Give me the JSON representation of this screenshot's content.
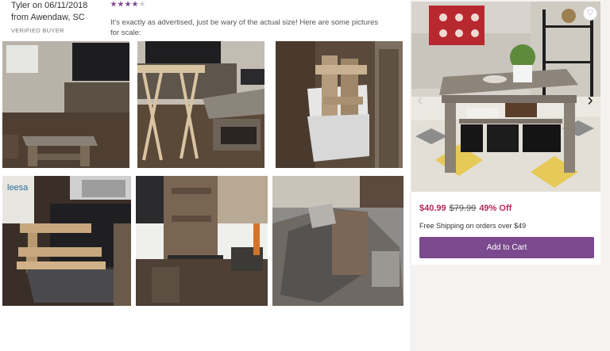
{
  "review": {
    "reviewer_line1": "Tyler on 06/11/2018",
    "reviewer_line2": "from Awendaw, SC",
    "verified": "VERIFIED BUYER",
    "rating": 4,
    "rating_max": 5,
    "text": "It's exactly as advertised, just be wary of the actual size! Here are some pictures for scale:"
  },
  "photos": [
    {
      "name": "review-photo-1"
    },
    {
      "name": "review-photo-2"
    },
    {
      "name": "review-photo-3"
    },
    {
      "name": "review-photo-4"
    },
    {
      "name": "review-photo-5"
    },
    {
      "name": "review-photo-6"
    }
  ],
  "product": {
    "price": "$40.99",
    "was_price": "$79.99",
    "discount": "49% Off",
    "shipping": "Free Shipping on orders over $49",
    "cart_label": "Add to Cart",
    "prev_icon": "‹",
    "next_icon": "›",
    "heart_icon": "♡"
  },
  "colors": {
    "accent": "#7b4a8e",
    "sale": "#b5285a"
  }
}
